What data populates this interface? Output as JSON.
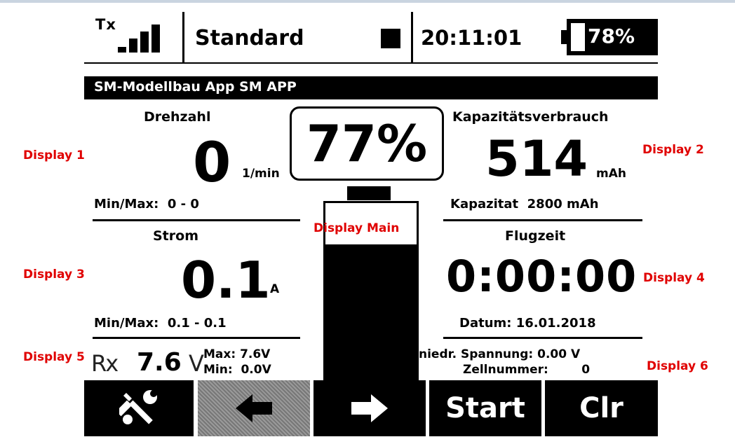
{
  "status_bar": {
    "tx_label": "Tx",
    "profile": "Standard",
    "time": "20:11:01",
    "battery_percent": "78%",
    "battery_level": 0.78
  },
  "title_bar": "SM-Modellbau App SM APP",
  "main": {
    "percent": "77%",
    "label": "Display Main",
    "bar_fill": 0.77
  },
  "display1": {
    "tag": "Display 1",
    "title": "Drehzahl",
    "value": "0",
    "unit": "1/min",
    "minmax": "Min/Max:  0 - 0"
  },
  "display2": {
    "tag": "Display 2",
    "title": "Kapazitätsverbrauch",
    "value": "514",
    "unit": "mAh",
    "footer": "Kapazitat  2800 mAh"
  },
  "display3": {
    "tag": "Display 3",
    "title": "Strom",
    "value": "0.1",
    "unit": "A",
    "minmax": "Min/Max:  0.1 - 0.1"
  },
  "display4": {
    "tag": "Display 4",
    "title": "Flugzeit",
    "value": "0:00:00",
    "footer": "Datum: 16.01.2018"
  },
  "display5": {
    "tag": "Display 5",
    "prefix": "Rx",
    "value": "7.6",
    "unit": "V",
    "max": "Max: 7.6V",
    "min": "Min:  0.0V"
  },
  "display6": {
    "tag": "Display 6",
    "line1": "niedr. Spannung: 0.00 V",
    "line2": "Zellnummer:        0"
  },
  "buttons": {
    "start": "Start",
    "clr": "Clr"
  },
  "icons": [
    "signal-bars-icon",
    "stop-icon",
    "battery-icon",
    "wrench-screwdriver-icon",
    "arrow-left-icon",
    "arrow-right-icon"
  ]
}
